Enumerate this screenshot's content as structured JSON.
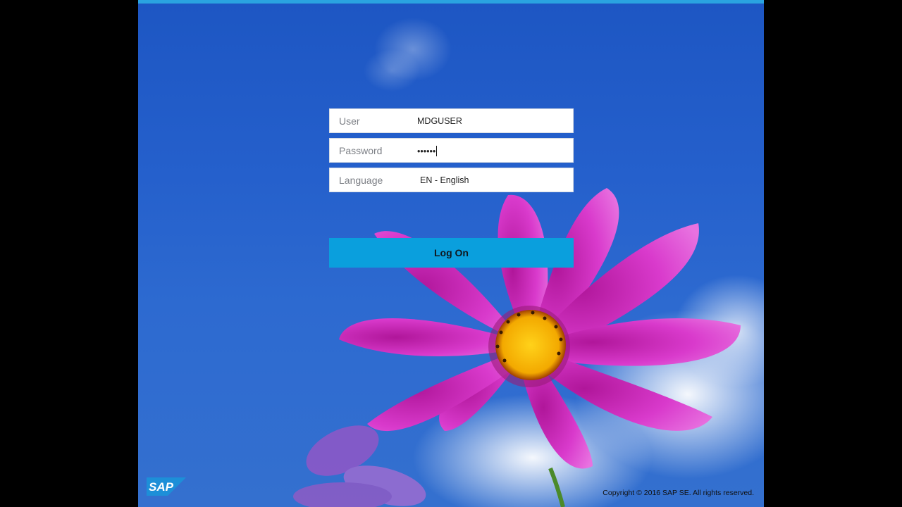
{
  "login": {
    "user": {
      "label": "User",
      "value": "MDGUSER"
    },
    "password": {
      "label": "Password",
      "value": "••••••"
    },
    "language": {
      "label": "Language",
      "value": "EN - English"
    },
    "logon_button": "Log On"
  },
  "footer": {
    "logo_text": "SAP",
    "copyright": "Copyright © 2016 SAP SE. All rights reserved."
  },
  "colors": {
    "accent": "#0a9fdd",
    "background_sky": "#2560cc",
    "flower": "#d42fc8"
  },
  "icons": {
    "logo": "sap-logo"
  }
}
